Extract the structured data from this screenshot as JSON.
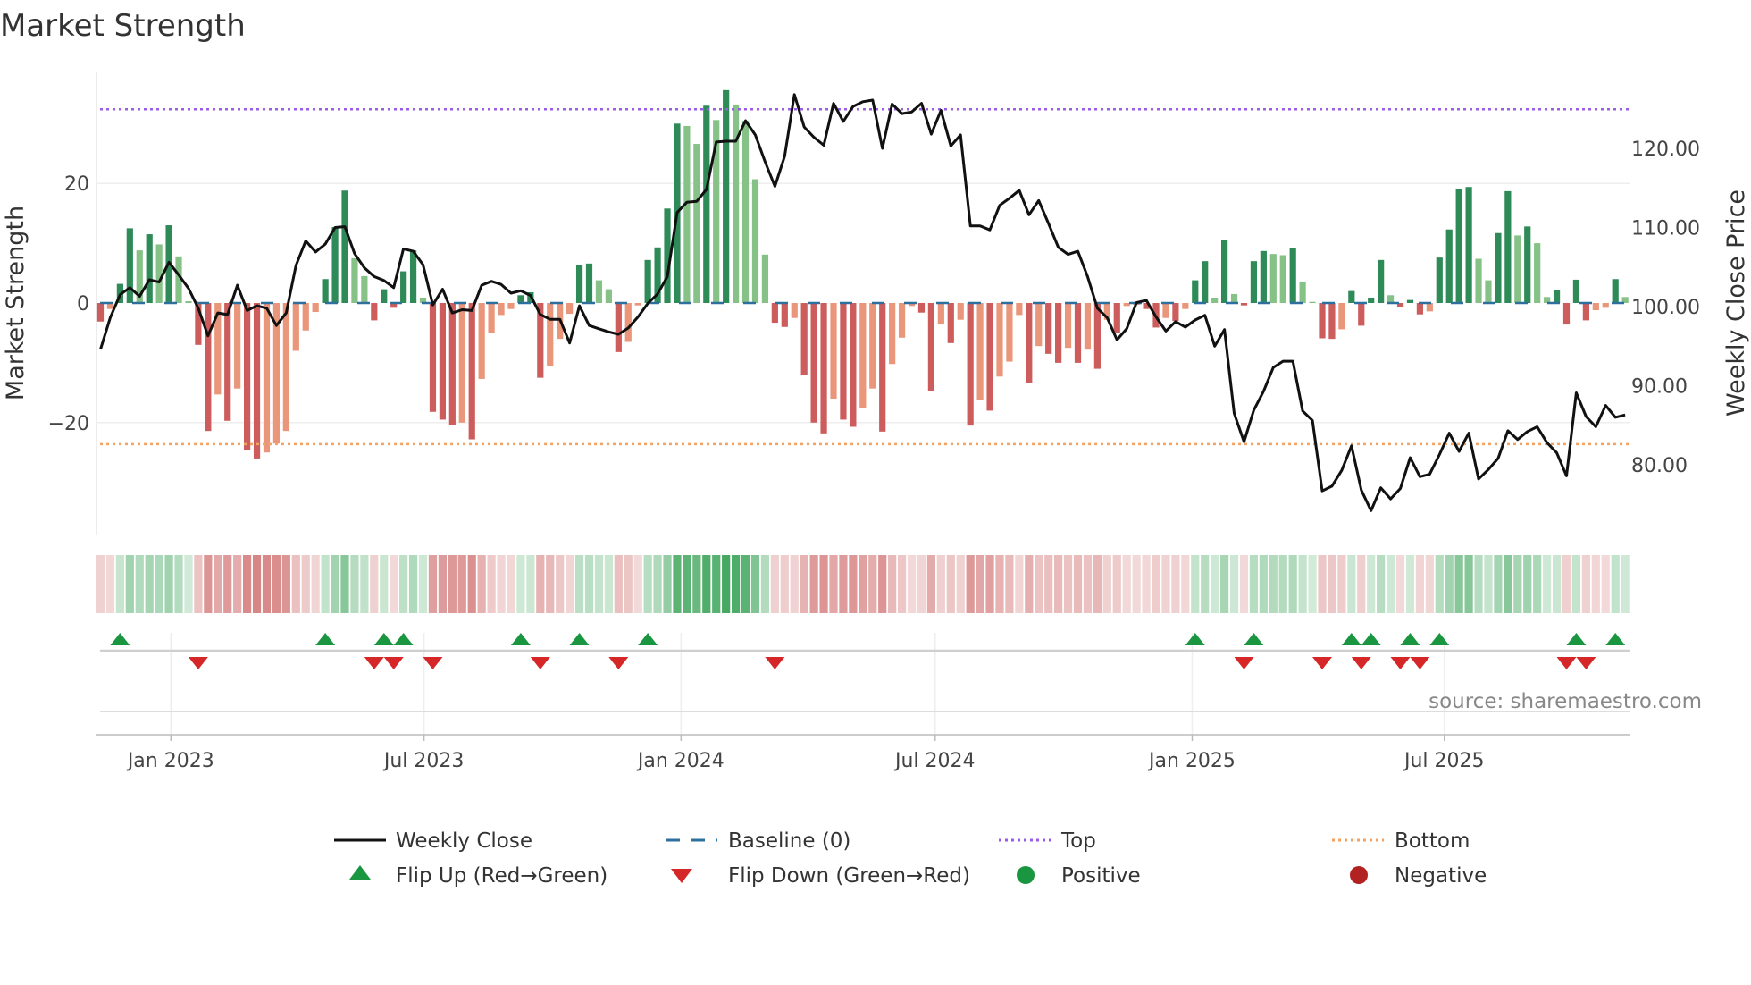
{
  "title": "Market Strength",
  "chart_data": {
    "type": "bar",
    "title": "Market Strength",
    "ylabel": "Market Strength",
    "y2label": "Weekly Close Price",
    "ylim": [
      -38.7,
      38.7
    ],
    "y2lim": [
      58.5,
      137
    ],
    "y_ticks": [
      {
        "v": 20,
        "label": "20"
      },
      {
        "v": 0,
        "label": "0"
      },
      {
        "v": -20,
        "label": "−20"
      }
    ],
    "y2_ticks": [
      {
        "v": 120,
        "label": "120.00"
      },
      {
        "v": 110,
        "label": "110.00"
      },
      {
        "v": 100,
        "label": "100.00"
      },
      {
        "v": 90,
        "label": "90.00"
      },
      {
        "v": 80,
        "label": "80.00"
      }
    ],
    "x_ticks": [
      {
        "week": 7.2,
        "label": "Jan 2023"
      },
      {
        "week": 33.1,
        "label": "Jul 2023"
      },
      {
        "week": 59.4,
        "label": "Jan 2024"
      },
      {
        "week": 85.4,
        "label": "Jul 2024"
      },
      {
        "week": 111.7,
        "label": "Jan 2025"
      },
      {
        "week": 137.5,
        "label": "Jul 2025"
      }
    ],
    "top_level": 32.4,
    "bottom_level": -23.6,
    "baseline": 0,
    "strength": [
      -3.1,
      -1,
      3.2,
      12.5,
      8.8,
      11.5,
      9.8,
      13,
      7.8,
      0.3,
      -7,
      -21.4,
      -15.3,
      -19.7,
      -14.3,
      -24.6,
      -26,
      -25,
      -23.5,
      -21.4,
      -8,
      -4.6,
      -1.5,
      4,
      12.7,
      18.8,
      7.5,
      4.5,
      -2.9,
      2.3,
      -0.8,
      5.3,
      8.8,
      0.9,
      -18.2,
      -19.5,
      -20.4,
      -20,
      -22.8,
      -12.7,
      -5,
      -2,
      -1,
      1.3,
      1.8,
      -12.5,
      -10.6,
      -6,
      -1.8,
      6.3,
      6.6,
      3.8,
      2.3,
      -8.2,
      -6.5,
      -0.4,
      7.2,
      9.3,
      15.8,
      30,
      29.6,
      26.6,
      33,
      30.6,
      35.6,
      33.2,
      30.5,
      20.7,
      8.1,
      -3.3,
      -4,
      -2.5,
      -12,
      -20,
      -21.8,
      -16,
      -19.5,
      -20.7,
      -17.5,
      -14.3,
      -21.5,
      -10.2,
      -5.8,
      -0.5,
      -1.6,
      -14.8,
      -3.6,
      -6.7,
      -2.8,
      -20.5,
      -16.2,
      -18,
      -12.3,
      -9.8,
      -2,
      -13.3,
      -7.2,
      -8.5,
      -10,
      -7.5,
      -10,
      -7.8,
      -11,
      -2.8,
      -5,
      -0.5,
      -0.3,
      -1,
      -4.1,
      -2.5,
      -3,
      -1,
      3.8,
      7,
      0.9,
      10.6,
      1.5,
      -0.4,
      7,
      8.7,
      8.2,
      8,
      9.2,
      3.6,
      0.2,
      -5.9,
      -6,
      -4.4,
      2,
      -3.8,
      0.9,
      7.2,
      1.3,
      -0.6,
      0.5,
      -1.9,
      -1.4,
      7.6,
      12.3,
      19.1,
      19.4,
      7.4,
      3.8,
      11.7,
      18.7,
      11.3,
      12.8,
      10,
      1,
      2.2,
      -3.6,
      3.9,
      -2.9,
      -1.2,
      -0.8,
      4,
      1
    ],
    "weekly_close": [
      94.6,
      98.6,
      101.5,
      102.4,
      101.3,
      103.4,
      103.1,
      105.6,
      104,
      102.3,
      99.8,
      96.3,
      99.2,
      99,
      102.7,
      99.5,
      100.1,
      99.8,
      97.6,
      99.2,
      105.2,
      108.3,
      106.9,
      107.9,
      110,
      110.1,
      106.7,
      104.9,
      103.8,
      103.3,
      102.4,
      107.3,
      107,
      105.3,
      100.2,
      102.2,
      99.2,
      99.6,
      99.5,
      102.7,
      103.2,
      102.8,
      101.7,
      102,
      101.4,
      99,
      98.4,
      98.4,
      95.4,
      100.1,
      97.6,
      97.2,
      96.8,
      96.5,
      97.3,
      98.7,
      100.4,
      101.6,
      103.8,
      111.9,
      113.2,
      113.3,
      114.8,
      120.8,
      120.9,
      120.9,
      123.5,
      121.7,
      118.3,
      115.2,
      119,
      126.8,
      122.7,
      121.4,
      120.4,
      125.7,
      123.4,
      125.3,
      125.9,
      126.1,
      120,
      125.6,
      124.4,
      124.6,
      125.7,
      121.8,
      124.8,
      120.3,
      121.7,
      110.2,
      110.2,
      109.7,
      112.8,
      113.7,
      114.7,
      111.6,
      113.4,
      110.5,
      107.5,
      106.6,
      107,
      103.8,
      99.8,
      98.6,
      95.8,
      97.2,
      100.5,
      100.8,
      98.7,
      96.9,
      98.1,
      97.4,
      98.3,
      98.9,
      95,
      97.1,
      86.5,
      82.9,
      86.9,
      89.3,
      92.3,
      93.1,
      93.1,
      86.8,
      85.6,
      76.7,
      77.3,
      79.3,
      82.4,
      76.8,
      74.2,
      77.1,
      75.7,
      77,
      80.9,
      78.5,
      78.8,
      81.3,
      84,
      81.7,
      84,
      78.2,
      79.4,
      80.8,
      84.3,
      83.2,
      84.2,
      84.8,
      82.8,
      81.5,
      78.6,
      89.1,
      86.1,
      84.8,
      87.5,
      86,
      86.3
    ],
    "flip_up_weeks": [
      2,
      23,
      29,
      31,
      43,
      49,
      56,
      112,
      118,
      128,
      130,
      134,
      137,
      151,
      155
    ],
    "flip_down_weeks": [
      10,
      28,
      30,
      34,
      45,
      53,
      69,
      117,
      125,
      129,
      133,
      135,
      150,
      152
    ],
    "legend_placement": "bottom"
  },
  "colors": {
    "pos_strong": "#2e8b57",
    "pos_weak": "#86c287",
    "neg_strong": "#cd5c5c",
    "neg_weak": "#e9967a",
    "line": "#111111",
    "baseline": "#2e6f9e",
    "top": "#9b5de5",
    "bottom": "#f4a261",
    "flip_up": "#1a9641",
    "flip_down": "#d62728",
    "positive": "#1a9641",
    "negative": "#b22222"
  },
  "legend": {
    "weekly_close": "Weekly Close",
    "baseline": "Baseline (0)",
    "top": "Top",
    "bottom": "Bottom",
    "flip_up": "Flip Up (Red→Green)",
    "flip_down": "Flip Down (Green→Red)",
    "positive": "Positive",
    "negative": "Negative"
  },
  "source": "source: sharemaestro.com"
}
